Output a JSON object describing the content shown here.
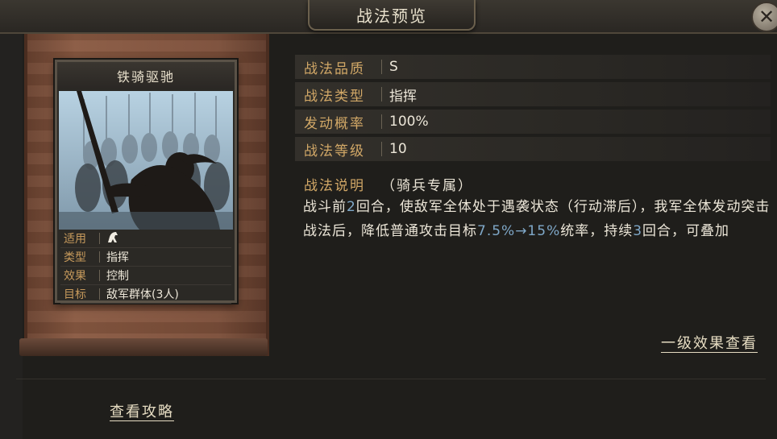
{
  "header": {
    "title": "战法预览"
  },
  "card": {
    "name": "铁骑驱驰",
    "stats": [
      {
        "key": "适用",
        "value": ""
      },
      {
        "key": "类型",
        "value": "指挥"
      },
      {
        "key": "效果",
        "value": "控制"
      },
      {
        "key": "目标",
        "value": "敌军群体(3人)"
      }
    ]
  },
  "info": {
    "rows": [
      {
        "key": "战法品质",
        "value": "S"
      },
      {
        "key": "战法类型",
        "value": "指挥"
      },
      {
        "key": "发动概率",
        "value": "100%"
      },
      {
        "key": "战法等级",
        "value": "10"
      }
    ],
    "desc_key": "战法说明",
    "desc_tag": "（骑兵专属）",
    "desc_parts": {
      "p1": "战斗前",
      "n1": "2",
      "p2": "回合，使敌军全体处于遇袭状态（行动滞后），我军全体发动突击战法后，降低普通攻击目标",
      "n2": "7.5%→15%",
      "p3": "统率，持续",
      "n3": "3",
      "p4": "回合，可叠加"
    }
  },
  "links": {
    "level_effect": "一级效果查看",
    "guide": "查看攻略"
  },
  "icons": {
    "close": "close-icon",
    "cavalry": "horse-icon"
  },
  "colors": {
    "key": "#d2a867",
    "highlight": "#7fa8c8",
    "text": "#ece6d8"
  }
}
